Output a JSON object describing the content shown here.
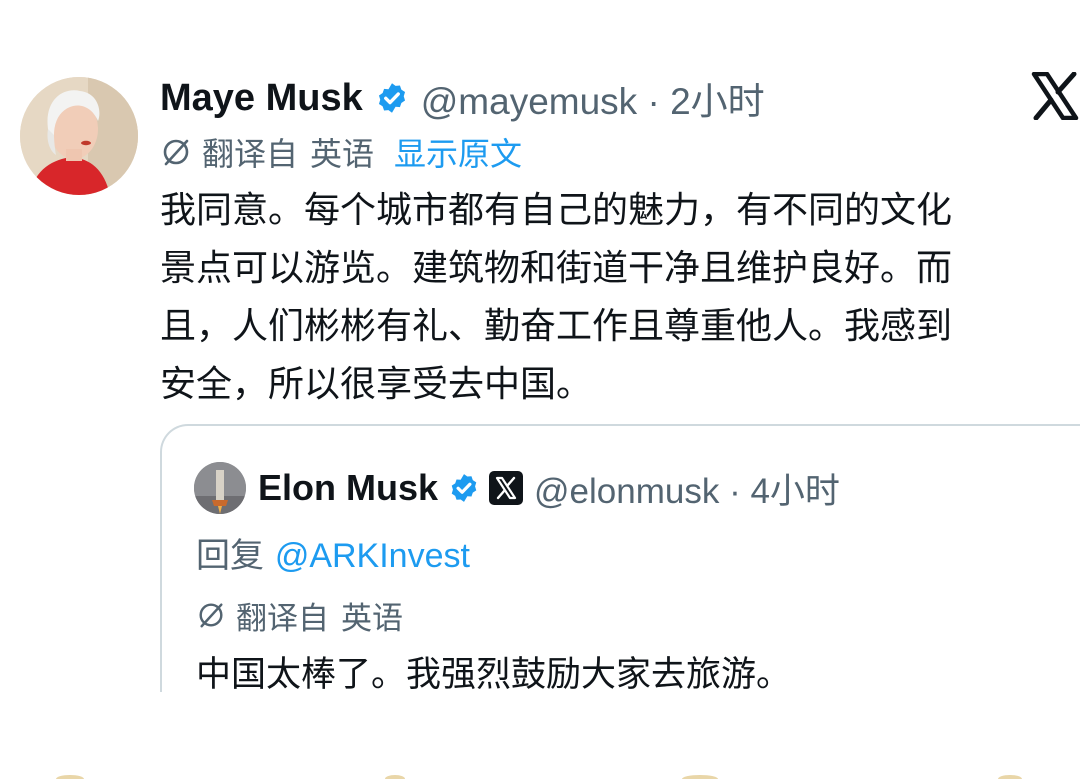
{
  "tweet": {
    "display_name": "Maye Musk",
    "handle_time": "@mayemusk · 2小时",
    "translated_from": "翻译自",
    "translated_lang": "英语",
    "show_original": "显示原文",
    "text_lines": [
      "我同意。每个城市都有自己的魅力，有不同的文化",
      "景点可以游览。建筑物和街道干净且维护良好。而",
      "且，人们彬彬有礼、勤奋工作且尊重他人。我感到",
      "安全，所以很享受去中国。"
    ]
  },
  "quoted": {
    "display_name": "Elon Musk",
    "handle_time": "@elonmusk · 4小时",
    "reply_prefix": "回复",
    "reply_mention": "@ARKInvest",
    "translated_from": "翻译自",
    "translated_lang": "英语",
    "text": "中国太棒了。我强烈鼓励大家去旅游。"
  },
  "colors": {
    "verified_blue": "#1d9bf0",
    "link_blue": "#1d9bf0",
    "secondary_text": "#536471",
    "primary_text": "#0f1419",
    "border": "#cfd9de"
  },
  "icons": [
    "verified-badge-icon",
    "x-logo-icon",
    "translate-globe-icon",
    "x-affiliation-badge-icon"
  ]
}
